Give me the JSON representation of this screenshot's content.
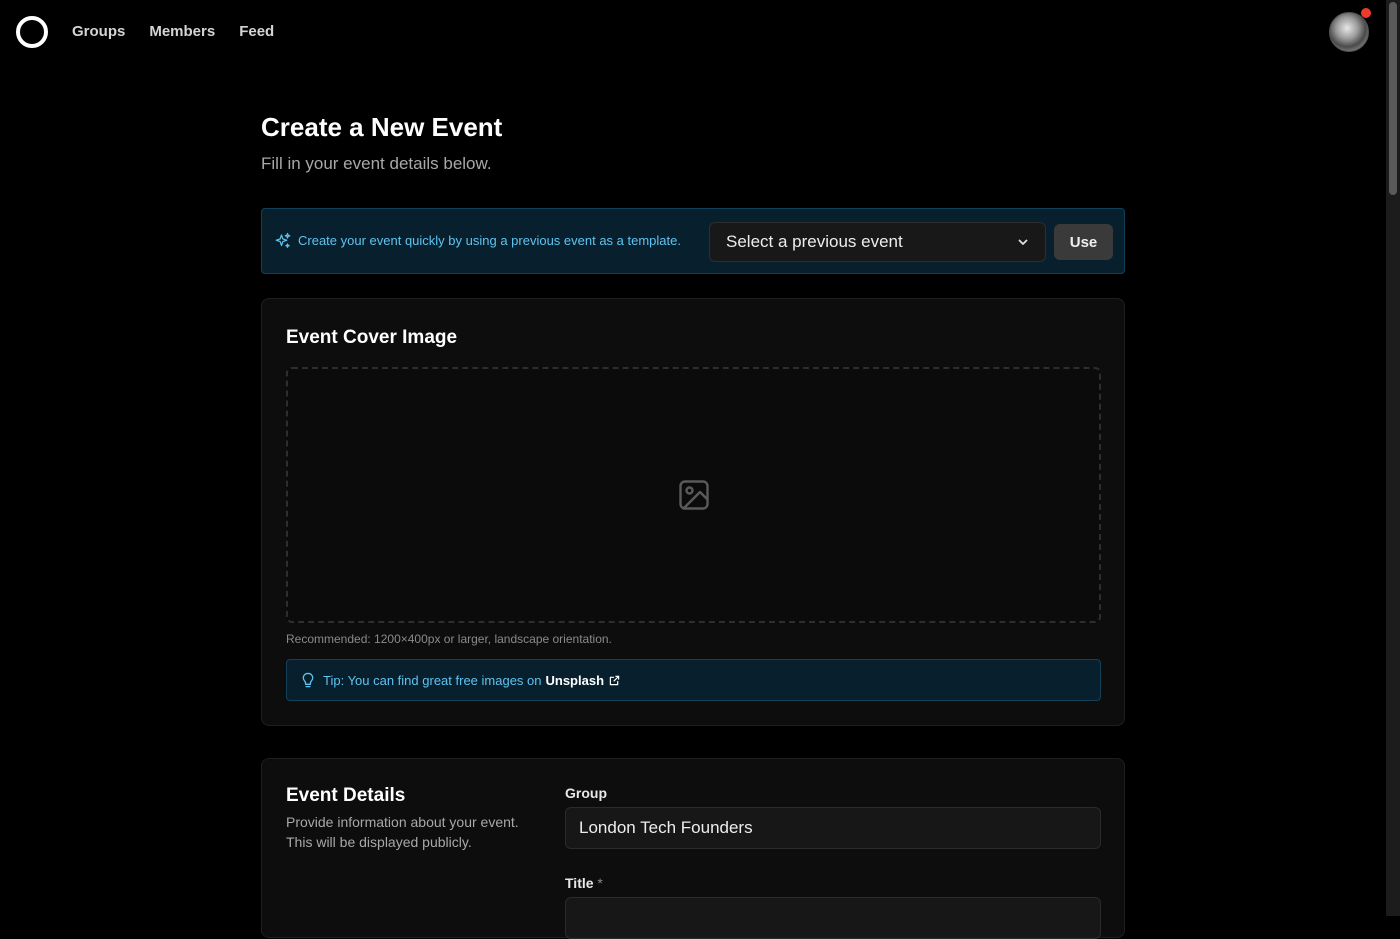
{
  "nav": {
    "links": [
      "Groups",
      "Members",
      "Feed"
    ]
  },
  "page": {
    "title": "Create a New Event",
    "subtitle": "Fill in your event details below."
  },
  "template": {
    "text": "Create your event quickly by using a previous event as a template.",
    "select_value": "Select a previous event",
    "use_label": "Use"
  },
  "cover": {
    "title": "Event Cover Image",
    "recommendation": "Recommended: 1200×400px or larger, landscape orientation.",
    "tip_prefix": "Tip: You can find great free images on",
    "tip_link": "Unsplash"
  },
  "details": {
    "title": "Event Details",
    "description": "Provide information about your event. This will be displayed publicly.",
    "group_label": "Group",
    "group_value": "London Tech Founders",
    "title_label": "Title",
    "title_required": "*",
    "title_value": ""
  },
  "colors": {
    "background": "#000000",
    "info_bg": "#08202e",
    "info_text": "#5fc3ef",
    "notification": "#ef3b2a"
  },
  "icons": [
    "logo-icon",
    "sparkles-icon",
    "chevron-down-icon",
    "image-icon",
    "lightbulb-icon",
    "external-link-icon",
    "avatar"
  ]
}
